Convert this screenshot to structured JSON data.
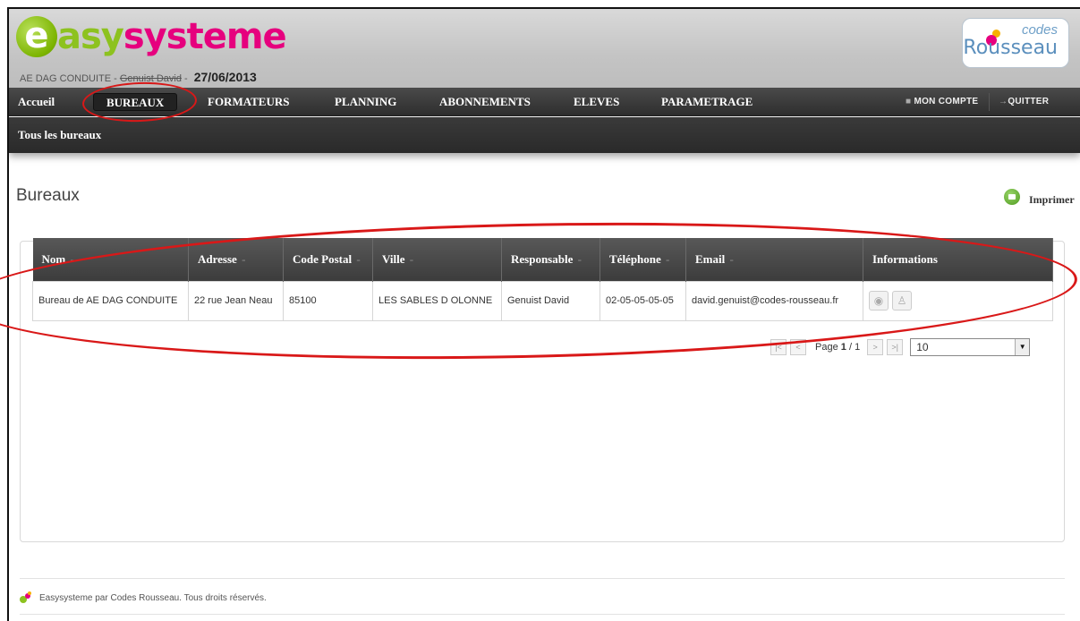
{
  "header": {
    "logo_e": "e",
    "logo_asy": "asy",
    "logo_sys": "systeme",
    "user_company": "AE DAG CONDUITE",
    "user_separator": " - ",
    "user_name": "Genuist David",
    "date_separator": " - ",
    "date": "27/06/2013",
    "partner_codes": "codes",
    "partner_name": "Rousseau"
  },
  "nav": {
    "items": [
      "Accueil",
      "BUREAUX",
      "FORMATEURS",
      "PLANNING",
      "ABONNEMENTS",
      "ELEVES",
      "PARAMETRAGE"
    ],
    "active": "BUREAUX",
    "account": "MON COMPTE",
    "quit": "QUITTER"
  },
  "subnav": {
    "item": "Tous les bureaux"
  },
  "page": {
    "title": "Bureaux",
    "print_label": "Imprimer"
  },
  "table": {
    "columns": [
      "Nom",
      "Adresse",
      "Code Postal",
      "Ville",
      "Responsable",
      "Téléphone",
      "Email",
      "Informations"
    ],
    "sort_glyph": "-",
    "rows": [
      {
        "nom": "Bureau de AE DAG CONDUITE",
        "adresse": "22 rue Jean Neau",
        "code_postal": "85100",
        "ville": "LES SABLES D OLONNE",
        "responsable": "Genuist David",
        "telephone": "02-05-05-05-05",
        "email": "david.genuist@codes-rousseau.fr"
      }
    ]
  },
  "pager": {
    "first": "|<",
    "prev": "<",
    "page_label": "Page",
    "current": "1",
    "total": "/ 1",
    "next": ">",
    "last": ">|",
    "page_size": "10"
  },
  "footer": {
    "text": "Easysysteme par Codes Rousseau. Tous droits réservés."
  },
  "colors": {
    "brand_green": "#8dc21f",
    "brand_pink": "#e6007e",
    "annotation_red": "#d91818",
    "nav_dark": "#2e2e2e"
  }
}
